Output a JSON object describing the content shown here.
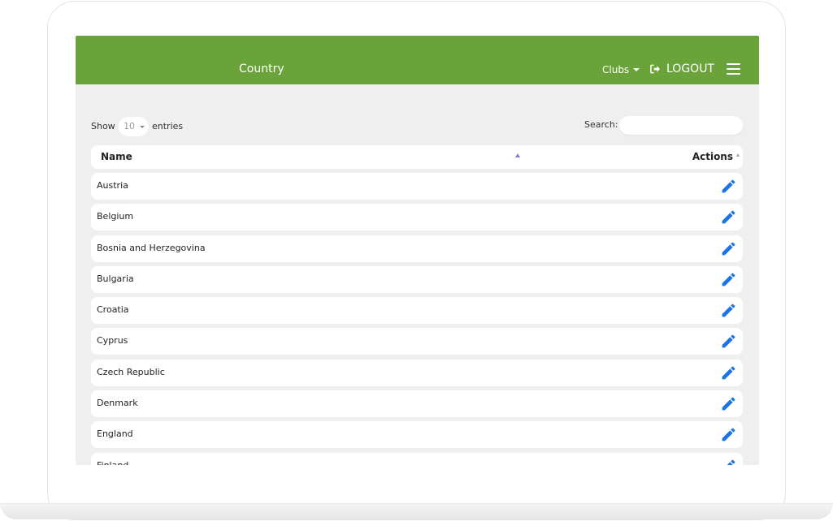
{
  "header": {
    "title": "Country",
    "clubs_label": "Clubs",
    "logout_label": "LOGOUT"
  },
  "controls": {
    "show_label": "Show",
    "length_value": "10",
    "entries_label": "entries",
    "search_label": "Search:",
    "search_value": ""
  },
  "table": {
    "columns": [
      "Name",
      "Actions"
    ],
    "rows": [
      {
        "name": "Austria"
      },
      {
        "name": "Belgium"
      },
      {
        "name": "Bosnia and Herzegovina"
      },
      {
        "name": "Bulgaria"
      },
      {
        "name": "Croatia"
      },
      {
        "name": "Cyprus"
      },
      {
        "name": "Czech Republic"
      },
      {
        "name": "Denmark"
      },
      {
        "name": "England"
      },
      {
        "name": "Finland"
      }
    ]
  },
  "icons": {
    "logout": "sign-out-icon",
    "menu": "hamburger-menu-icon",
    "edit": "pencil-edit-icon"
  },
  "colors": {
    "navbar": "#6aa33a",
    "edit_icon": "#1a73e8",
    "background": "#efefef"
  }
}
